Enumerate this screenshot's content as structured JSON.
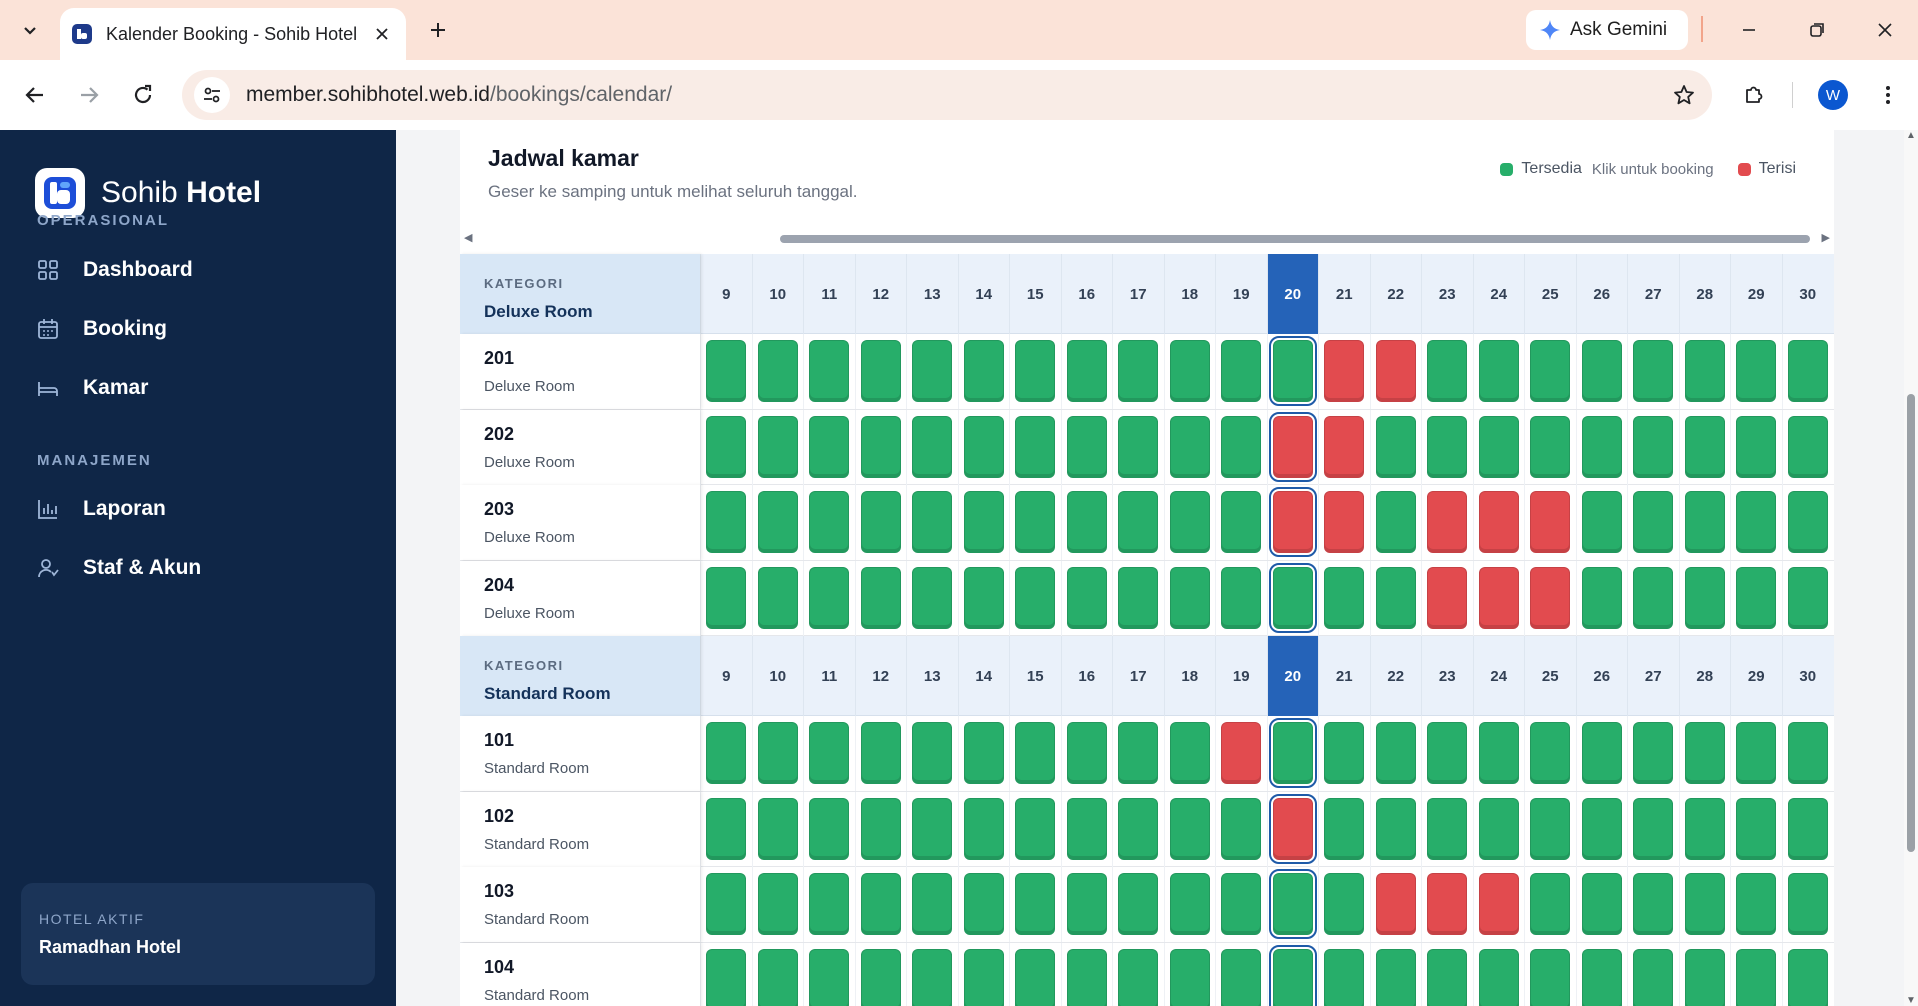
{
  "browser": {
    "tab_title": "Kalender Booking - Sohib Hotel",
    "ask_gemini": "Ask Gemini",
    "url_host": "member.sohibhotel.web.id",
    "url_path": "/bookings/calendar/",
    "profile_initial": "W"
  },
  "sidebar": {
    "brand_light": "Sohib",
    "brand_bold": "Hotel",
    "section_ops": "OPERASIONAL",
    "section_mgmt": "MANAJEMEN",
    "items": [
      {
        "label": "Dashboard",
        "icon": "grid-icon"
      },
      {
        "label": "Booking",
        "icon": "calendar-icon"
      },
      {
        "label": "Kamar",
        "icon": "bed-icon"
      },
      {
        "label": "Laporan",
        "icon": "bar-chart-icon"
      },
      {
        "label": "Staf & Akun",
        "icon": "user-icon"
      }
    ],
    "hotel_label": "HOTEL AKTIF",
    "hotel_name": "Ramadhan Hotel"
  },
  "calendar": {
    "title": "Jadwal kamar",
    "subtitle": "Geser ke samping untuk melihat seluruh tanggal.",
    "legend_available": "Tersedia",
    "legend_hint": "Klik untuk booking",
    "legend_occupied": "Terisi",
    "category_label": "KATEGORI",
    "dates": [
      "9",
      "10",
      "11",
      "12",
      "13",
      "14",
      "15",
      "16",
      "17",
      "18",
      "19",
      "20",
      "21",
      "22",
      "23",
      "24",
      "25",
      "26",
      "27",
      "28",
      "29",
      "30"
    ],
    "today": "20",
    "colors": {
      "available": "#27ae6a",
      "occupied": "#e24b4f",
      "today": "#2563b8"
    },
    "categories": [
      {
        "name": "Deluxe Room",
        "rooms": [
          {
            "number": "201",
            "type": "Deluxe Room",
            "occupied": [
              "21",
              "22"
            ]
          },
          {
            "number": "202",
            "type": "Deluxe Room",
            "occupied": [
              "20",
              "21"
            ]
          },
          {
            "number": "203",
            "type": "Deluxe Room",
            "occupied": [
              "20",
              "21",
              "23",
              "24",
              "25"
            ]
          },
          {
            "number": "204",
            "type": "Deluxe Room",
            "occupied": [
              "23",
              "24",
              "25"
            ]
          }
        ]
      },
      {
        "name": "Standard Room",
        "rooms": [
          {
            "number": "101",
            "type": "Standard Room",
            "occupied": [
              "19"
            ]
          },
          {
            "number": "102",
            "type": "Standard Room",
            "occupied": [
              "20"
            ]
          },
          {
            "number": "103",
            "type": "Standard Room",
            "occupied": [
              "22",
              "23",
              "24"
            ]
          },
          {
            "number": "104",
            "type": "Standard Room",
            "occupied": []
          }
        ]
      }
    ]
  }
}
